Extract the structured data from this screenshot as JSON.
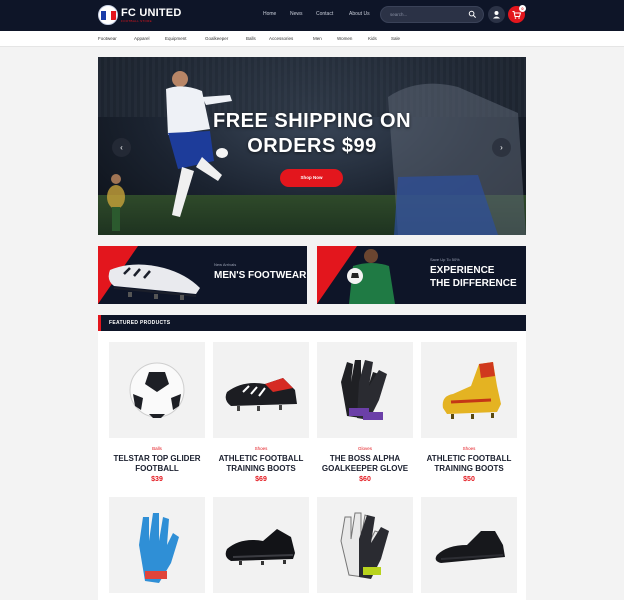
{
  "header": {
    "brand": "FC UNITED",
    "tagline": "FOOTBALL STORE",
    "nav": [
      "Home",
      "News",
      "Contact",
      "About Us"
    ],
    "search_placeholder": "search...",
    "cart_count": "0"
  },
  "categories": [
    "Footwear",
    "Apparel",
    "Equipment",
    "Goalkeeper",
    "Balls",
    "Accessories",
    "Men",
    "Women",
    "Kids",
    "Sale"
  ],
  "hero": {
    "title_line1": "FREE SHIPPING ON",
    "title_line2": "ORDERS $99",
    "button": "Shop Now"
  },
  "banners": [
    {
      "small": "New Arrivals",
      "line1": "MEN'S FOOTWEAR",
      "line2": ""
    },
    {
      "small": "Save Up To 50%",
      "line1": "EXPERIENCE",
      "line2": "THE DIFFERENCE"
    }
  ],
  "featured": {
    "title": "FEATURED PRODUCTS",
    "products": [
      {
        "category": "Balls",
        "name_line1": "TELSTAR TOP GLIDER",
        "name_line2": "FOOTBALL",
        "price": "$39",
        "icon": "soccer-ball-icon"
      },
      {
        "category": "Shoes",
        "name_line1": "ATHLETIC FOOTBALL",
        "name_line2": "TRAINING BOOTS",
        "price": "$69",
        "icon": "football-boot-icon"
      },
      {
        "category": "Gloves",
        "name_line1": "THE BOSS ALPHA",
        "name_line2": "GOALKEEPER GLOVE",
        "price": "$60",
        "icon": "goalkeeper-glove-icon"
      },
      {
        "category": "Shoes",
        "name_line1": "ATHLETIC FOOTBALL",
        "name_line2": "TRAINING BOOTS",
        "price": "$50",
        "icon": "football-boot-icon"
      }
    ]
  },
  "colors": {
    "accent": "#e3161d",
    "navy": "#0e1528"
  }
}
